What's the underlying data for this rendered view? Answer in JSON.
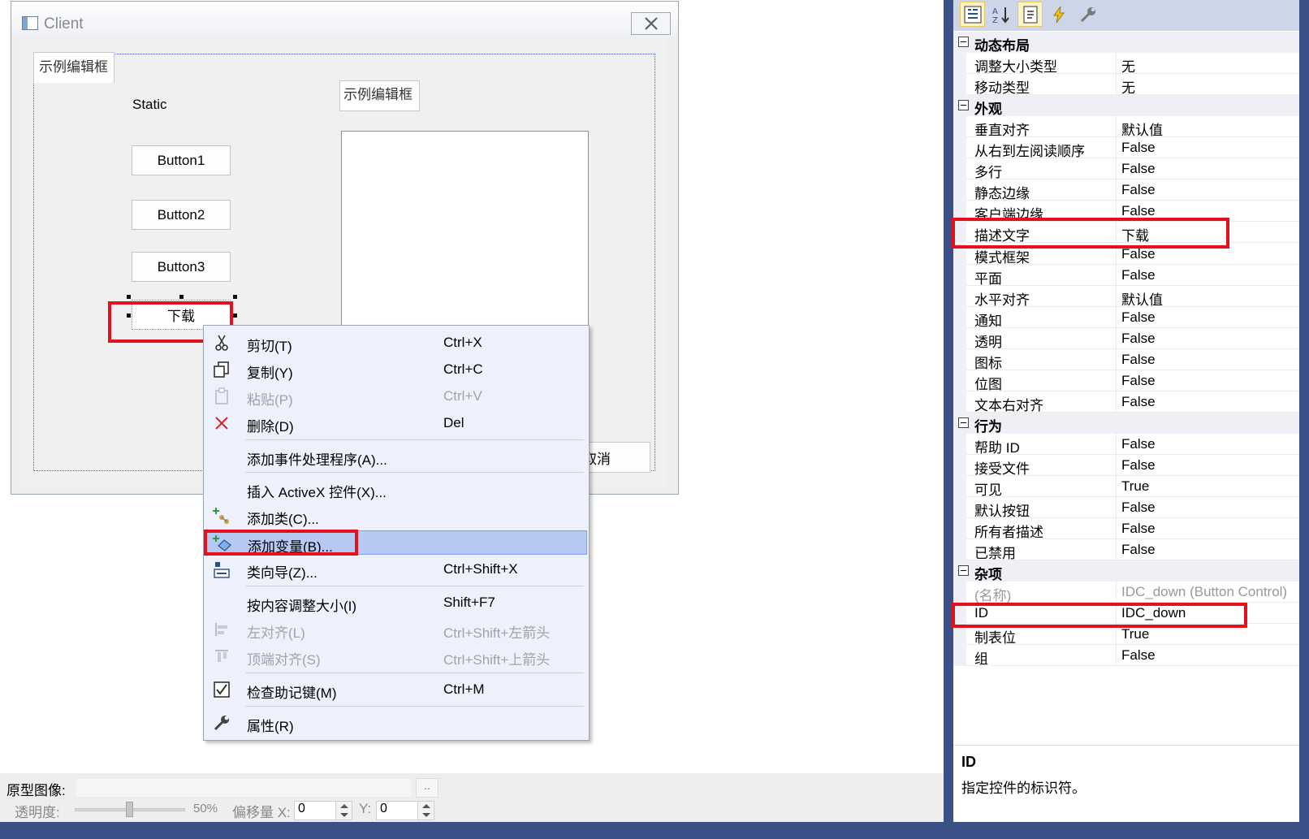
{
  "dialog": {
    "title": "Client",
    "groupbox1_label": "示例编辑框",
    "groupbox2_label": "示例编辑框",
    "static_label": "Static",
    "buttons": [
      "Button1",
      "Button2",
      "Button3"
    ],
    "selected_button_label": "下载",
    "cancel_label": "取消"
  },
  "context_menu": {
    "items": [
      {
        "label": "剪切(T)",
        "shortcut": "Ctrl+X",
        "icon": "scissors-icon",
        "disabled": false
      },
      {
        "label": "复制(Y)",
        "shortcut": "Ctrl+C",
        "icon": "copy-icon",
        "disabled": false
      },
      {
        "label": "粘贴(P)",
        "shortcut": "Ctrl+V",
        "icon": "paste-icon",
        "disabled": true
      },
      {
        "label": "删除(D)",
        "shortcut": "Del",
        "icon": "delete-icon",
        "disabled": false
      },
      {
        "label": "添加事件处理程序(A)...",
        "shortcut": "",
        "icon": "",
        "disabled": false
      },
      {
        "label": "插入 ActiveX 控件(X)...",
        "shortcut": "",
        "icon": "",
        "disabled": false
      },
      {
        "label": "添加类(C)...",
        "shortcut": "",
        "icon": "add-class-icon",
        "disabled": false
      },
      {
        "label": "添加变量(B)...",
        "shortcut": "",
        "icon": "add-variable-icon",
        "disabled": false,
        "highlighted": true
      },
      {
        "label": "类向导(Z)...",
        "shortcut": "Ctrl+Shift+X",
        "icon": "class-wizard-icon",
        "disabled": false
      },
      {
        "label": "按内容调整大小(I)",
        "shortcut": "Shift+F7",
        "icon": "",
        "disabled": false
      },
      {
        "label": "左对齐(L)",
        "shortcut": "Ctrl+Shift+左箭头",
        "icon": "align-left-icon",
        "disabled": true
      },
      {
        "label": "顶端对齐(S)",
        "shortcut": "Ctrl+Shift+上箭头",
        "icon": "align-top-icon",
        "disabled": true
      },
      {
        "label": "检查助记键(M)",
        "shortcut": "Ctrl+M",
        "icon": "check-mnemonic-icon",
        "disabled": false
      },
      {
        "label": "属性(R)",
        "shortcut": "",
        "icon": "wrench-icon",
        "disabled": false
      }
    ]
  },
  "bottom_panel": {
    "proto_label": "原型图像:",
    "browse_label": "..",
    "opacity_label": "透明度:",
    "opacity_value": "50%",
    "offset_x_label": "偏移量 X:",
    "offset_x_value": "0",
    "offset_y_label": "Y:",
    "offset_y_value": "0"
  },
  "property_grid": {
    "toolbar": [
      "categorized-icon",
      "alphabetical-icon",
      "properties-icon",
      "events-icon",
      "wrench-icon"
    ],
    "categories": [
      {
        "name": "动态布局",
        "props": [
          [
            "调整大小类型",
            "无"
          ],
          [
            "移动类型",
            "无"
          ]
        ]
      },
      {
        "name": "外观",
        "props": [
          [
            "垂直对齐",
            "默认值"
          ],
          [
            "从右到左阅读顺序",
            "False"
          ],
          [
            "多行",
            "False"
          ],
          [
            "静态边缘",
            "False"
          ],
          [
            "客户端边缘",
            "False"
          ],
          [
            "描述文字",
            "下载"
          ],
          [
            "模式框架",
            "False"
          ],
          [
            "平面",
            "False"
          ],
          [
            "水平对齐",
            "默认值"
          ],
          [
            "通知",
            "False"
          ],
          [
            "透明",
            "False"
          ],
          [
            "图标",
            "False"
          ],
          [
            "位图",
            "False"
          ],
          [
            "文本右对齐",
            "False"
          ]
        ]
      },
      {
        "name": "行为",
        "props": [
          [
            "帮助 ID",
            "False"
          ],
          [
            "接受文件",
            "False"
          ],
          [
            "可见",
            "True"
          ],
          [
            "默认按钮",
            "False"
          ],
          [
            "所有者描述",
            "False"
          ],
          [
            "已禁用",
            "False"
          ]
        ]
      },
      {
        "name": "杂项",
        "props": [
          [
            "(名称)",
            "IDC_down (Button Control)"
          ],
          [
            "ID",
            "IDC_down"
          ],
          [
            "制表位",
            "True"
          ],
          [
            "组",
            "False"
          ]
        ]
      }
    ],
    "description_title": "ID",
    "description_text": "指定控件的标识符。"
  },
  "colors": {
    "highlight_red": "#e5101e",
    "menu_highlight": "#b7c9f3",
    "ide_blue": "#3c4f86"
  }
}
